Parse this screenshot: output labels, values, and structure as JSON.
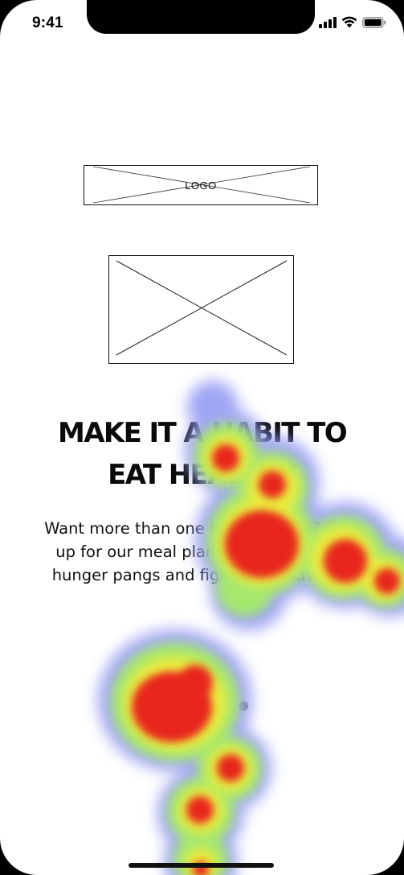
{
  "status_bar": {
    "time": "9:41",
    "icons": [
      "signal-icon",
      "wifi-icon",
      "battery-icon"
    ]
  },
  "logo": {
    "label": "LOGO"
  },
  "hero_image": {
    "kind": "image-placeholder"
  },
  "headline": {
    "line1": "MAKE IT A HABIT TO",
    "line2": "EAT HEALTHY"
  },
  "body": {
    "line1": "Want more than one healthy meal? Sign",
    "line2": "up for our meal plans and avoid daily",
    "line3": "hunger pangs and fight your cravings."
  },
  "pager": {
    "count": 3,
    "active_index": 2
  },
  "colors": {
    "text": "#0a0a0a",
    "heat_hot": "#e8261e",
    "heat_warm": "#f3e83a",
    "heat_mid": "#9fe86a",
    "heat_cool": "#8f95f2"
  }
}
